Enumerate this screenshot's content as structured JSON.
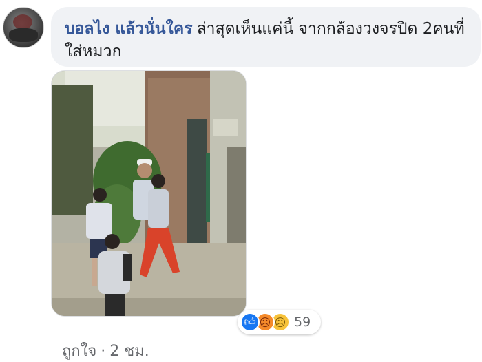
{
  "comment": {
    "author": "บอลไง แล้วนั่นใคร",
    "text": "ล่าสุดเห็นแค่นี้ จากกล้องวงจรปิด 2คนที่ใส่หมวก"
  },
  "reactions": {
    "icons": [
      "like-icon",
      "angry-icon",
      "sad-icon"
    ],
    "count": "59"
  },
  "actions": {
    "like_label": "ถูกใจ",
    "separator": "·",
    "time": "2 ชม."
  }
}
